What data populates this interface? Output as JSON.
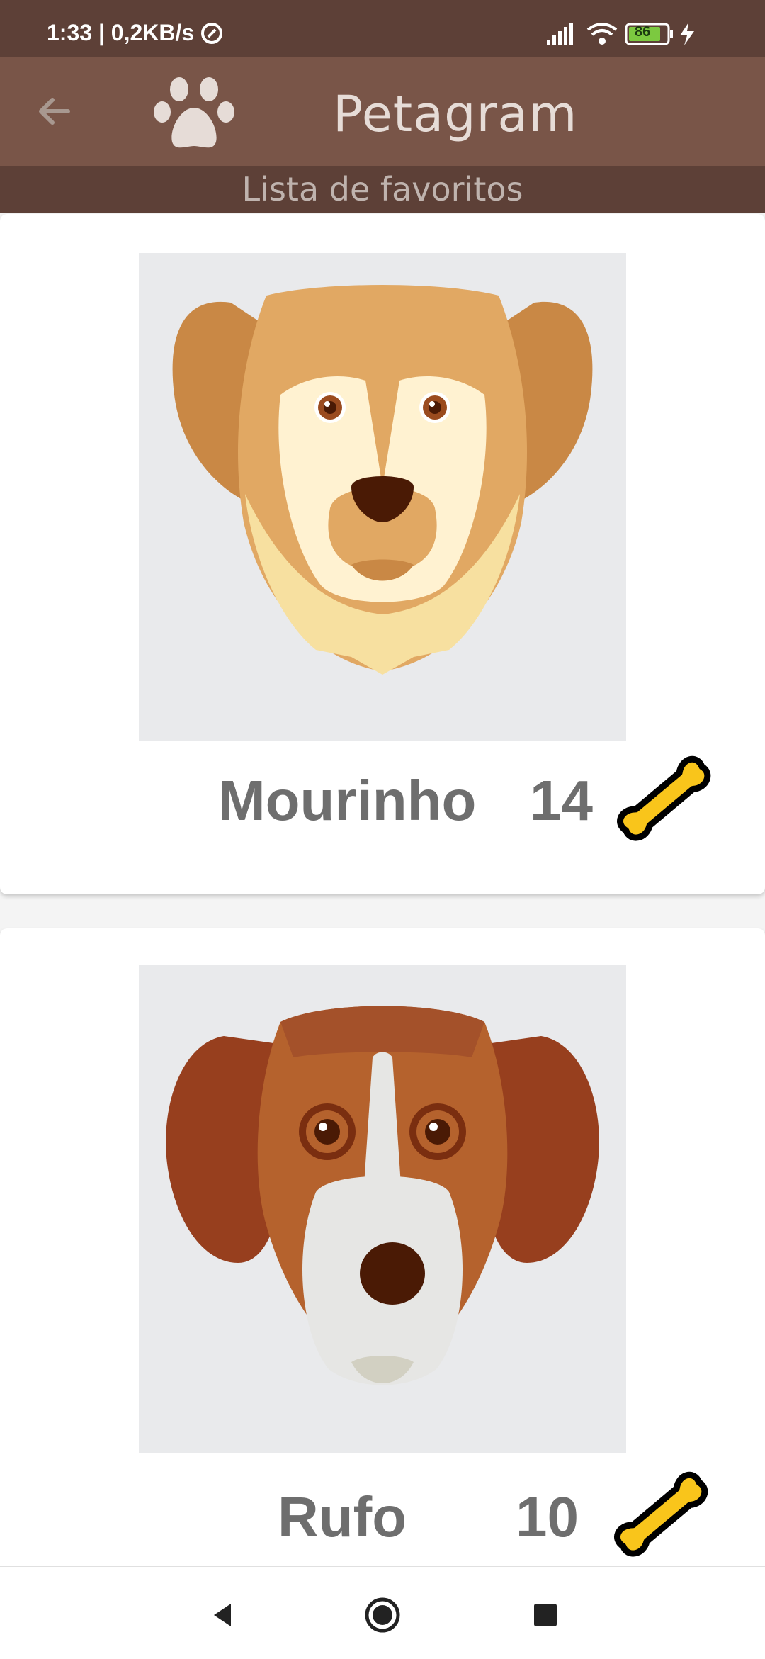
{
  "status_bar": {
    "time": "1:33 | 0,2KB/s",
    "battery": "86"
  },
  "app_bar": {
    "title": "Petagram",
    "back_icon": "arrow-back-icon",
    "logo_icon": "paw-icon"
  },
  "subtitle": "Lista de favoritos",
  "pets": [
    {
      "name": "Mourinho",
      "likes": "14",
      "icon": "bone-icon"
    },
    {
      "name": "Rufo",
      "likes": "10",
      "icon": "bone-icon"
    }
  ],
  "nav": {
    "back": "nav-back-icon",
    "home": "nav-home-icon",
    "recent": "nav-recent-icon"
  },
  "colors": {
    "status_bar": "#5d4037",
    "app_bar": "#795548",
    "bone_fill": "#f9c51b"
  }
}
